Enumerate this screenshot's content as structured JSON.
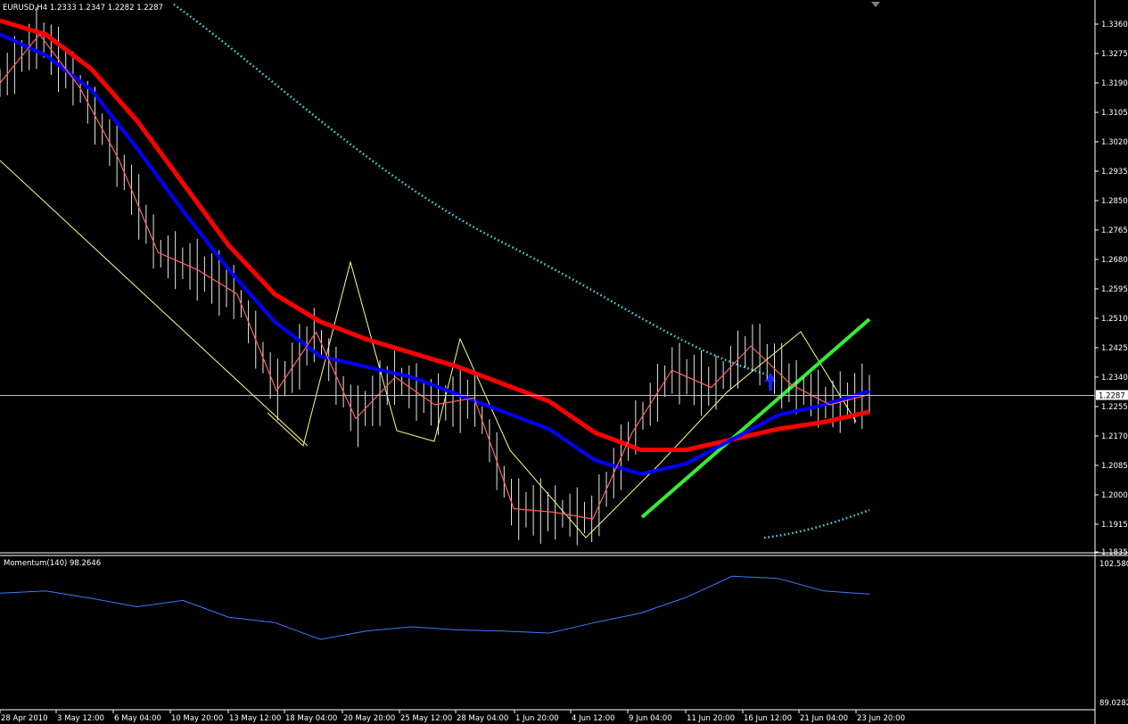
{
  "window": {
    "symbol_info": "EURUSD,H4  1.2333 1.2347 1.2282 1.2287"
  },
  "price_panel": {
    "y_axis": {
      "min": 1.1835,
      "max": 1.336,
      "ticks": [
        "1.3360",
        "1.3275",
        "1.3190",
        "1.3105",
        "1.3020",
        "1.2935",
        "1.2850",
        "1.2765",
        "1.2680",
        "1.2595",
        "1.2510",
        "1.2425",
        "1.2340",
        "1.2255",
        "1.2170",
        "1.2085",
        "1.2000",
        "1.1915",
        "1.1835"
      ]
    },
    "current_price": 1.2287,
    "current_price_label": "1.2287"
  },
  "momentum_panel": {
    "label": "Momentum(140) 98.2646",
    "top_label": "102.580",
    "bottom_label": "89.0282",
    "min": 89.0282,
    "max": 102.58
  },
  "x_axis": {
    "labels": [
      "28 Apr 2010",
      "3 May 12:00",
      "6 May 04:00",
      "10 May 20:00",
      "13 May 12:00",
      "18 May 04:00",
      "20 May 20:00",
      "25 May 12:00",
      "28 May 04:00",
      "1 Jun 20:00",
      "4 Jun 12:00",
      "9 Jun 04:00",
      "11 Jun 20:00",
      "16 Jun 12:00",
      "21 Jun 04:00",
      "23 Jun 20:00"
    ]
  },
  "colors": {
    "background": "#000000",
    "axis": "#ffffff",
    "ema_fast": "#ff0000",
    "ema_slow": "#0000ff",
    "price_line": "#ff6060",
    "zigzag": "#ffff80",
    "dotted": "#40e0e0",
    "trend": "#33ee33",
    "momentum": "#3b7bff",
    "current_line": "#c0c0c0"
  },
  "chart_data": [
    {
      "type": "line",
      "name": "EURUSD H4 price",
      "x": [
        "28 Apr 2010",
        "3 May 12:00",
        "6 May 04:00",
        "10 May 20:00",
        "13 May 12:00",
        "18 May 04:00",
        "20 May 20:00",
        "25 May 12:00",
        "28 May 04:00",
        "1 Jun 20:00",
        "4 Jun 12:00",
        "9 Jun 04:00",
        "11 Jun 20:00",
        "16 Jun 12:00",
        "21 Jun 04:00",
        "23 Jun 20:00"
      ],
      "series": [
        {
          "values": [
            1.319,
            1.333,
            1.318,
            1.297,
            1.27,
            1.265,
            1.258,
            1.23,
            1.247,
            1.222,
            1.234,
            1.226,
            1.228,
            1.196,
            1.195,
            1.193,
            1.218,
            1.236,
            1.231,
            1.243,
            1.232,
            1.226,
            1.229
          ]
        },
        {
          "values": [
            1.333,
            1.327,
            1.317,
            1.3,
            1.282,
            1.265,
            1.25,
            1.24,
            1.237,
            1.234,
            1.229,
            1.224,
            1.219,
            1.21,
            1.206,
            1.209,
            1.216,
            1.223,
            1.226,
            1.23
          ]
        },
        {
          "values": [
            1.337,
            1.333,
            1.323,
            1.308,
            1.29,
            1.272,
            1.258,
            1.25,
            1.245,
            1.241,
            1.237,
            1.232,
            1.227,
            1.218,
            1.213,
            1.213,
            1.216,
            1.219,
            1.221,
            1.224
          ]
        }
      ],
      "ylim": [
        1.1835,
        1.336
      ]
    },
    {
      "type": "line",
      "name": "Momentum(140)",
      "x": [
        "28 Apr 2010",
        "3 May 12:00",
        "6 May 04:00",
        "10 May 20:00",
        "13 May 12:00",
        "18 May 04:00",
        "20 May 20:00",
        "25 May 12:00",
        "28 May 04:00",
        "1 Jun 20:00",
        "4 Jun 12:00",
        "9 Jun 04:00",
        "11 Jun 20:00",
        "16 Jun 12:00",
        "21 Jun 04:00",
        "23 Jun 20:00"
      ],
      "series": [
        {
          "values": [
            99.6,
            99.8,
            99.1,
            98.3,
            98.9,
            97.3,
            96.8,
            95.2,
            96.0,
            96.4,
            96.1,
            96.0,
            95.8,
            96.8,
            97.7,
            99.2,
            101.2,
            101.0,
            99.8,
            99.5
          ]
        }
      ],
      "ylim": [
        89.0282,
        102.58
      ]
    }
  ]
}
